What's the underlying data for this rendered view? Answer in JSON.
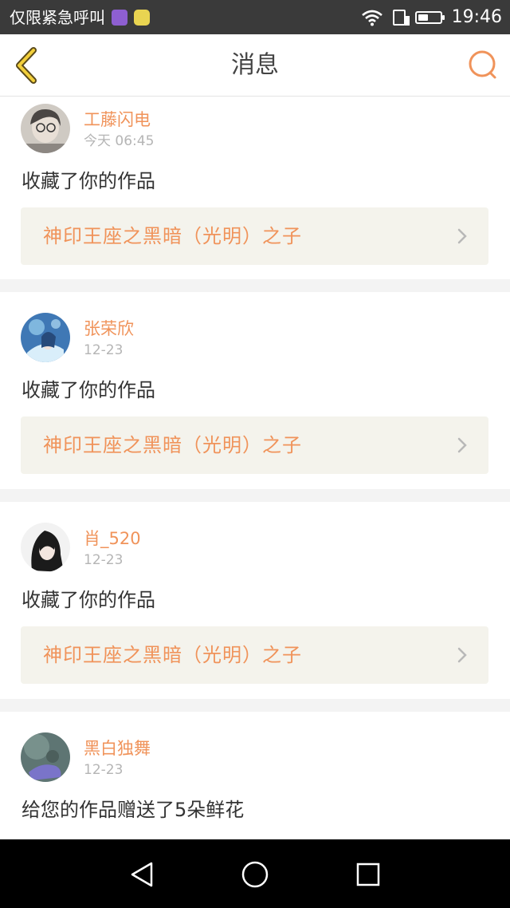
{
  "status_bar": {
    "left_text": "仅限紧急呼叫",
    "icons_left": [
      "gallery-app-icon",
      "chat-app-icon"
    ],
    "icons_right": [
      "wifi-icon",
      "sim-icon",
      "battery-icon"
    ],
    "battery_level": 0.45,
    "time": "19:46"
  },
  "header": {
    "title": "消息",
    "back_icon": "chevron-left-icon",
    "search_icon": "search-icon",
    "accent": "#f0935a"
  },
  "messages": [
    {
      "name": "工藤闪电",
      "time": "今天 06:45",
      "action": "收藏了你的作品",
      "work": "神印王座之黑暗（光明）之子",
      "avatar_color": "#9b9894"
    },
    {
      "name": "张荣欣",
      "time": "12-23",
      "action": "收藏了你的作品",
      "work": "神印王座之黑暗（光明）之子",
      "avatar_color": "#4b7fb8"
    },
    {
      "name": "肖_520",
      "time": "12-23",
      "action": "收藏了你的作品",
      "work": "神印王座之黑暗（光明）之子",
      "avatar_color": "#2a2a2a"
    },
    {
      "name": "黑白独舞",
      "time": "12-23",
      "action": "给您的作品赠送了5朵鲜花",
      "avatar_color": "#6a7a78"
    }
  ],
  "nav_bar": {
    "back": "triangle-back-icon",
    "home": "circle-home-icon",
    "recents": "square-recents-icon"
  }
}
